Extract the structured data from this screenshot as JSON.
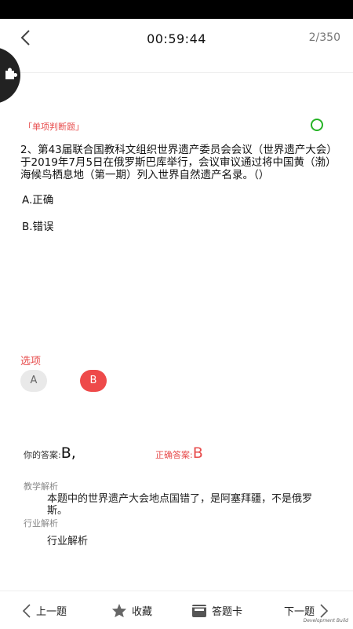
{
  "header": {
    "timer": "00:59:44",
    "progress": "2/350"
  },
  "question": {
    "type_label": "「单项判断题」",
    "text": "2、第43届联合国教科文组织世界遗产委员会会议（世界遗产大会）于2019年7月5日在俄罗斯巴库举行，会议审议通过将中国黄（渤）海候鸟栖息地（第一期）列入世界自然遗产名录。（）",
    "options": [
      {
        "label": "A.正确"
      },
      {
        "label": "B.错误"
      }
    ]
  },
  "choices": {
    "label": "选项",
    "items": [
      "A",
      "B"
    ],
    "selected": "B"
  },
  "answer": {
    "your_label": "你的答案:",
    "your_value": "B,",
    "correct_label": "正确答案:",
    "correct_value": "B"
  },
  "analysis": {
    "teaching_title": "教学解析",
    "teaching_text": "本题中的世界遗产大会地点国错了，是阿塞拜疆，不是俄罗斯。",
    "industry_title": "行业解析",
    "industry_text": "行业解析"
  },
  "bottom_nav": {
    "prev": "上一题",
    "favorite": "收藏",
    "answer_card": "答题卡",
    "next": "下一题"
  },
  "watermark": "Development Build",
  "colors": {
    "accent_red": "#e74c4c",
    "selected_choice": "#ee4a4a",
    "status_circle": "#25b325"
  }
}
